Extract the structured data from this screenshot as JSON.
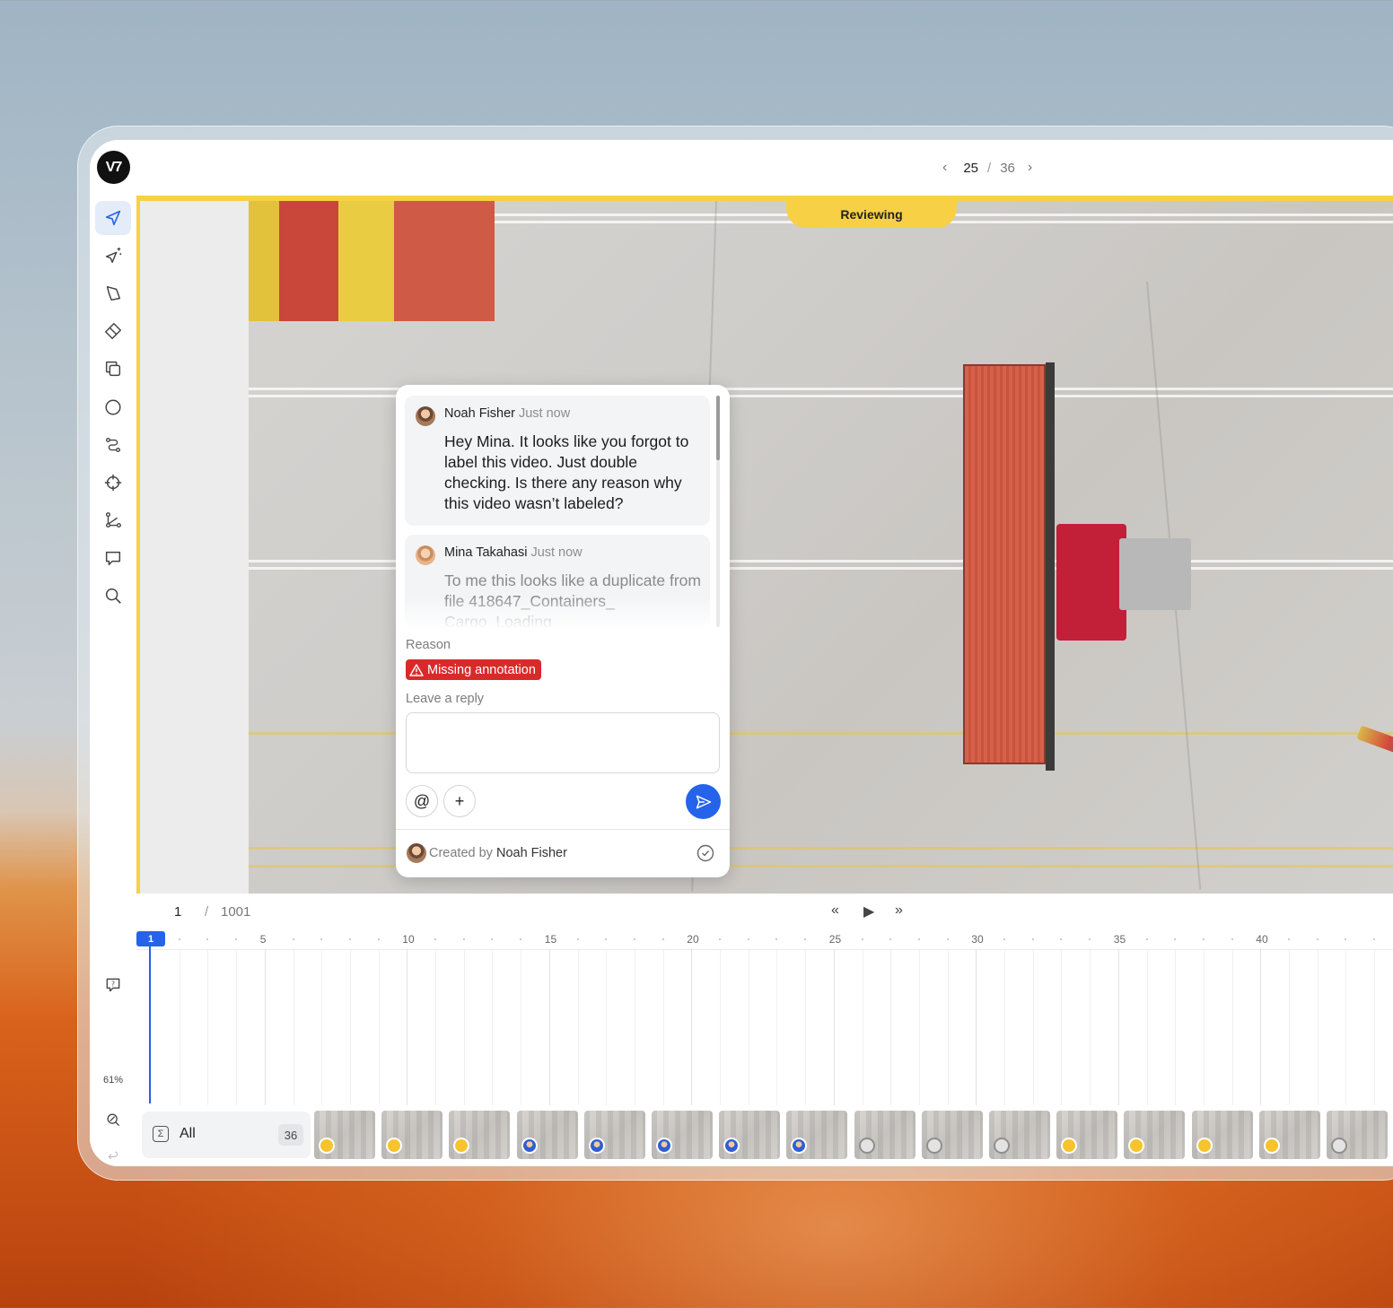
{
  "app": {
    "logo_text": "V7"
  },
  "pager": {
    "current": "25",
    "separator": "/",
    "total": "36",
    "prev_icon": "chevron-left-icon",
    "next_icon": "chevron-right-icon"
  },
  "toolbar": {
    "tools": [
      "cursor-icon",
      "auto-annotate-icon",
      "polygon-icon",
      "brush-icon",
      "clone-icon",
      "ellipse-icon",
      "polyline-icon",
      "keypoint-icon",
      "skeleton-icon",
      "comment-icon",
      "zoom-icon"
    ],
    "bottom": {
      "help_icon": "help-icon",
      "zoom_level": "61%",
      "image-manipulation_icon": "image-adjust-icon",
      "undo_icon": "undo-icon",
      "redo_icon": "redo-icon"
    }
  },
  "canvas": {
    "status_tab": "Reviewing"
  },
  "comment_thread": {
    "messages": [
      {
        "author": "Noah Fisher",
        "time": "Just now",
        "text": "Hey Mina. It looks like you forgot to label this video. Just double checking. Is there any reason why this video wasn’t labeled?"
      },
      {
        "author": "Mina Takahasi",
        "time": "Just now",
        "text": "To me this looks like a duplicate from file 418647_Containers_ Cargo_Loading"
      }
    ],
    "reason_label": "Reason",
    "reason_badge": "Missing annotation",
    "reply_label": "Leave a reply",
    "reply_value": "",
    "mention_button": "@",
    "add_button": "+",
    "footer_prefix": "Created by",
    "footer_author": "Noah Fisher"
  },
  "timeline": {
    "current_frame": "1",
    "separator": "/",
    "total_frames": "1001",
    "controls": {
      "rewind": "«",
      "play": "▶",
      "forward": "»"
    },
    "cursor_label": "1",
    "tick_labels": [
      "5",
      "10",
      "15",
      "20",
      "25",
      "30",
      "35",
      "40"
    ]
  },
  "filter": {
    "label": "All",
    "count": "36"
  },
  "thumbnails": [
    "y",
    "y",
    "y",
    "u",
    "u",
    "u",
    "u",
    "u",
    "g",
    "g",
    "g",
    "y",
    "y",
    "y",
    "y",
    "g"
  ]
}
